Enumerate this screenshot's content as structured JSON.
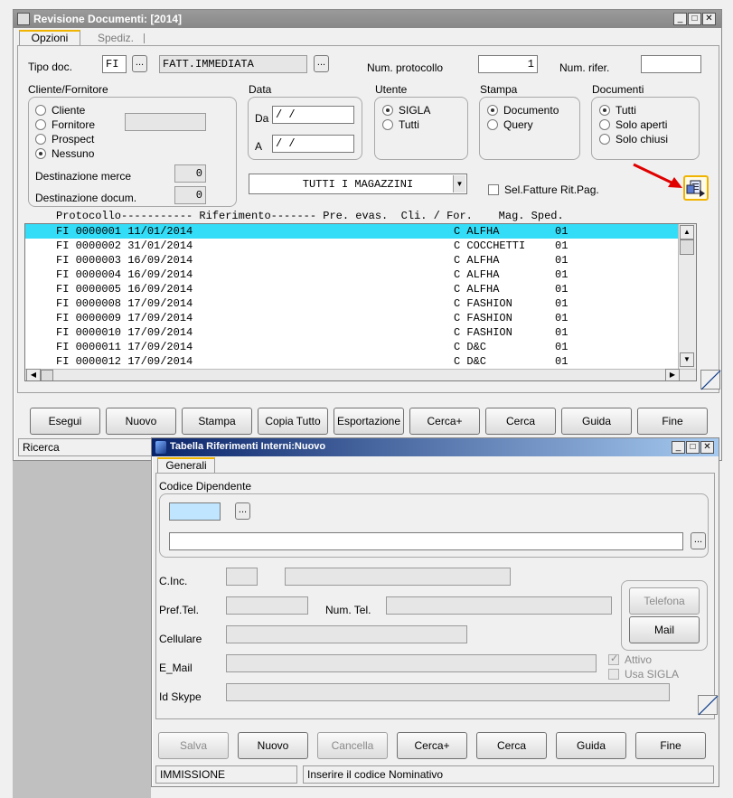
{
  "main": {
    "title": "Revisione Documenti: [2014]",
    "tabs": [
      "Opzioni",
      "Spediz."
    ],
    "tipo_doc_label": "Tipo doc.",
    "tipo_doc_value": "FI",
    "tipo_doc_desc": "FATT.IMMEDIATA",
    "num_protocollo_label": "Num. protocollo",
    "num_protocollo_value": "1",
    "num_rifer_label": "Num. rifer.",
    "num_rifer_value": "",
    "cliente_group_label": "Cliente/Fornitore",
    "cliente_options": [
      "Cliente",
      "Fornitore",
      "Prospect",
      "Nessuno"
    ],
    "cliente_selected": 3,
    "dest_merce_label": "Destinazione merce",
    "dest_merce_value": "0",
    "dest_docum_label": "Destinazione docum.",
    "dest_docum_value": "0",
    "data_label": "Data",
    "data_da_label": "Da",
    "data_da_value": "  /  /",
    "data_a_label": "A",
    "data_a_value": "  /  /",
    "utente_label": "Utente",
    "utente_options": [
      "SIGLA",
      "Tutti"
    ],
    "utente_selected": 0,
    "stampa_label": "Stampa",
    "stampa_options": [
      "Documento",
      "Query"
    ],
    "stampa_selected": 0,
    "documenti_label": "Documenti",
    "documenti_options": [
      "Tutti",
      "Solo aperti",
      "Solo chiusi"
    ],
    "documenti_selected": 0,
    "magazzini_value": "TUTTI I MAGAZZINI",
    "sel_fatture_label": "Sel.Fatture Rit.Pag.",
    "sel_fatture_checked": false,
    "list_header": "Protocollo----------- Riferimento------- Pre. evas.  Cli. / For.    Mag. Sped.",
    "rows": [
      {
        "proto": "FI 0000001 11/01/2014",
        "clifor": "C ALFHA",
        "mag": "01",
        "selected": true
      },
      {
        "proto": "FI 0000002 31/01/2014",
        "clifor": "C COCCHETTI",
        "mag": "01",
        "selected": false
      },
      {
        "proto": "FI 0000003 16/09/2014",
        "clifor": "C ALFHA",
        "mag": "01",
        "selected": false
      },
      {
        "proto": "FI 0000004 16/09/2014",
        "clifor": "C ALFHA",
        "mag": "01",
        "selected": false
      },
      {
        "proto": "FI 0000005 16/09/2014",
        "clifor": "C ALFHA",
        "mag": "01",
        "selected": false
      },
      {
        "proto": "FI 0000008 17/09/2014",
        "clifor": "C FASHION",
        "mag": "01",
        "selected": false
      },
      {
        "proto": "FI 0000009 17/09/2014",
        "clifor": "C FASHION",
        "mag": "01",
        "selected": false
      },
      {
        "proto": "FI 0000010 17/09/2014",
        "clifor": "C FASHION",
        "mag": "01",
        "selected": false
      },
      {
        "proto": "FI 0000011 17/09/2014",
        "clifor": "C D&C",
        "mag": "01",
        "selected": false
      },
      {
        "proto": "FI 0000012 17/09/2014",
        "clifor": "C D&C",
        "mag": "01",
        "selected": false
      }
    ],
    "buttons": [
      "Esegui",
      "Nuovo",
      "Stampa",
      "Copia Tutto",
      "Esportazione",
      "Cerca+",
      "Cerca",
      "Guida",
      "Fine"
    ],
    "status": "Ricerca",
    "selection_color": "#33ddf8"
  },
  "dialog": {
    "title": "Tabella Riferimenti Interni:Nuovo",
    "tab": "Generali",
    "codice_dipendente_label": "Codice Dipendente",
    "codice_value": "",
    "nominativo_value": "",
    "cinc_label": "C.Inc.",
    "pref_tel_label": "Pref.Tel.",
    "num_tel_label": "Num. Tel.",
    "cellulare_label": "Cellulare",
    "email_label": "E_Mail",
    "skype_label": "Id Skype",
    "telefona_label": "Telefona",
    "mail_label": "Mail",
    "attivo_label": "Attivo",
    "attivo_checked": true,
    "usa_sigla_label": "Usa SIGLA",
    "usa_sigla_checked": false,
    "buttons": [
      "Salva",
      "Nuovo",
      "Cancella",
      "Cerca+",
      "Cerca",
      "Guida",
      "Fine"
    ],
    "disabled_buttons": [
      0,
      2
    ],
    "status_left": "IMMISSIONE",
    "status_right": "Inserire il codice Nominativo"
  }
}
